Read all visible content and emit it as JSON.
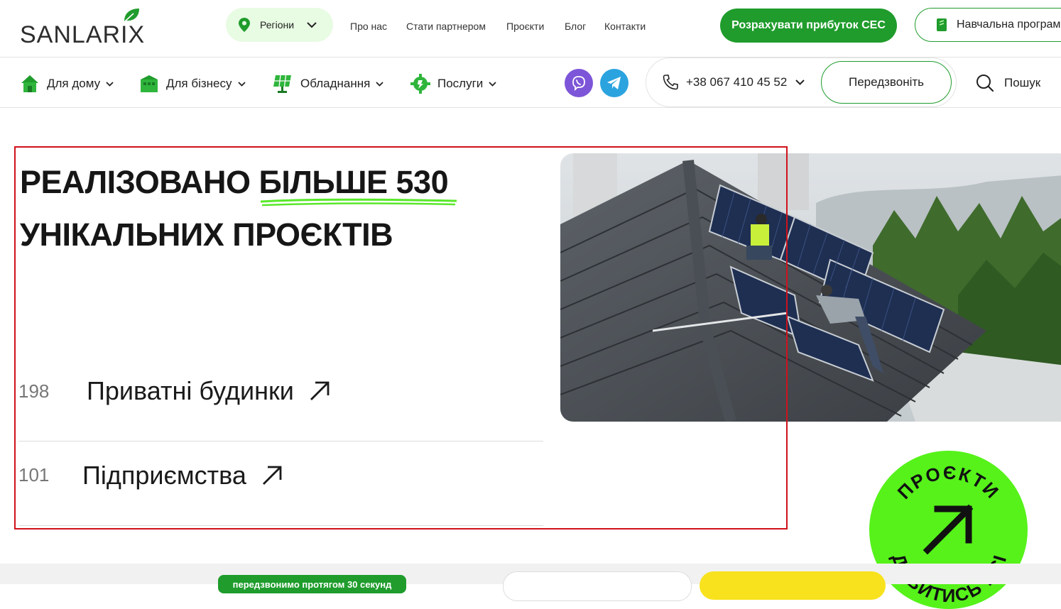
{
  "brand": {
    "name": "SANLARIX",
    "accent": "#1f9c2c",
    "lime": "#56f21a"
  },
  "header": {
    "regions_label": "Регіони",
    "nav": [
      "Про нас",
      "Стати партнером",
      "Проєкти",
      "Блог",
      "Контакти"
    ],
    "cta_label": "Розрахувати прибуток СЕС",
    "edu_label": "Навчальна програма"
  },
  "menu": {
    "items": [
      {
        "label": "Для дому",
        "icon": "house-icon"
      },
      {
        "label": "Для бізнесу",
        "icon": "business-building-icon"
      },
      {
        "label": "Обладнання",
        "icon": "solar-panel-icon"
      },
      {
        "label": "Послуги",
        "icon": "service-gear-icon"
      }
    ],
    "phone": "+38 067 410 45 52",
    "callback_label": "Передзвоніть",
    "search_label": "Пошук"
  },
  "hero": {
    "title_part1": "РЕАЛІЗОВАНО ",
    "title_highlight": "БІЛЬШЕ 530",
    "title_part2": "УНІКАЛЬНИХ ПРОЄКТІВ",
    "categories": [
      {
        "count": "198",
        "name": "Приватні будинки"
      },
      {
        "count": "101",
        "name": "Підприємства"
      }
    ],
    "badge_text_top": "ПРОЄКТИ",
    "badge_text_bottom": "ДИВИТИСЬ ВСІ"
  },
  "footer_strip": {
    "note": "передзвонимо протягом 30 секунд"
  }
}
